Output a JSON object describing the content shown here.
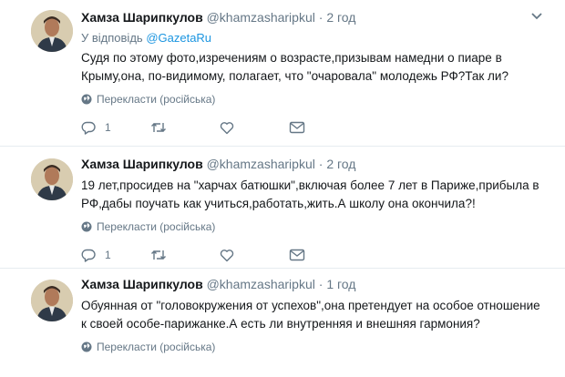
{
  "tweets": [
    {
      "name": "Хамза Шарипкулов",
      "handle": "@khamzasharipkul",
      "separator": "·",
      "time": "2 год",
      "reply_prefix": "У відповідь",
      "reply_mention": "@GazetaRu",
      "text": "Судя по этому фото,изречениям о возрасте,призывам намедни о  пиаре в Крыму,она, по-видимому, полагает, что \"очаровала\" молодежь РФ?Так ли?",
      "translate": "Перекласти (російська)",
      "reply_count": "1"
    },
    {
      "name": "Хамза Шарипкулов",
      "handle": "@khamzasharipkul",
      "separator": "·",
      "time": "2 год",
      "text": "19 лет,просидев на \"харчах батюшки\",включая более 7 лет в Париже,прибыла в РФ,дабы поучать как учиться,работать,жить.А школу она окончила?!",
      "translate": "Перекласти (російська)",
      "reply_count": "1"
    },
    {
      "name": "Хамза Шарипкулов",
      "handle": "@khamzasharipkul",
      "separator": "·",
      "time": "1 год",
      "text": "Обуянная от \"головокружения от успехов\",она претендует на особое отношение к своей особе-парижанке.А есть ли внутренняя и внешняя гармония?",
      "translate": "Перекласти (російська)"
    }
  ],
  "icons": [
    "chevron-down-icon",
    "globe-icon",
    "reply-icon",
    "retweet-icon",
    "heart-icon",
    "message-icon"
  ],
  "colors": {
    "name": "#14171a",
    "secondary": "#657786",
    "link": "#1b95e0",
    "divider": "#e6ecf0"
  }
}
